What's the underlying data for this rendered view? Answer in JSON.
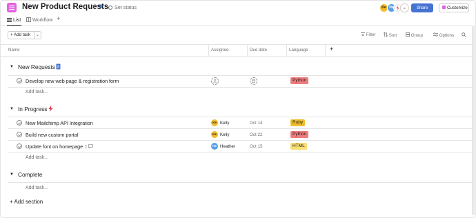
{
  "project": {
    "title": "New Product Requests",
    "status_label": "Set status",
    "share_label": "Share",
    "customize_label": "Customize",
    "members": [
      {
        "initials": "Ke",
        "color": "#f1bd2b"
      },
      {
        "initials": "He",
        "color": "#5aa0e6"
      }
    ],
    "more_members": "•••"
  },
  "tabs": [
    {
      "label": "List",
      "active": true
    },
    {
      "label": "Workflow",
      "active": false
    }
  ],
  "toolbar": {
    "add_task": "+ Add task",
    "filter": "Filter",
    "sort": "Sort",
    "group": "Group",
    "options": "Options"
  },
  "columns": {
    "name": "Name",
    "assignee": "Assignee",
    "due_date": "Due date",
    "language": "Language"
  },
  "sections": [
    {
      "title": "New Requests",
      "icon": "document-icon",
      "add_task": "Add task...",
      "tasks": [
        {
          "name": "Develop new web page & registration form",
          "assignee": null,
          "due": null,
          "language": "Python",
          "language_color": "#f07c7c"
        }
      ]
    },
    {
      "title": "In Progress",
      "icon": "lightning-icon",
      "add_task": "Add task...",
      "tasks": [
        {
          "name": "New Mailchimp API Integration",
          "assignee": "Kelly",
          "initials": "Ke",
          "avatar_color": "#f1bd2b",
          "due": "Oct 14",
          "language": "Ruby",
          "language_color": "#f1bd2b"
        },
        {
          "name": "Build new custom portal",
          "assignee": "Kelly",
          "initials": "Ke",
          "avatar_color": "#f1bd2b",
          "due": "Oct 22",
          "language": "Python",
          "language_color": "#f07c7c"
        },
        {
          "name": "Update font on homepage",
          "comments": "1",
          "assignee": "Heather",
          "initials": "He",
          "avatar_color": "#5aa0e6",
          "due": "Oct 15",
          "language": "HTML",
          "language_color": "#f8df72"
        }
      ]
    },
    {
      "title": "Complete",
      "icon": null,
      "add_task": "Add task...",
      "tasks": []
    }
  ],
  "add_section": "+ Add section"
}
